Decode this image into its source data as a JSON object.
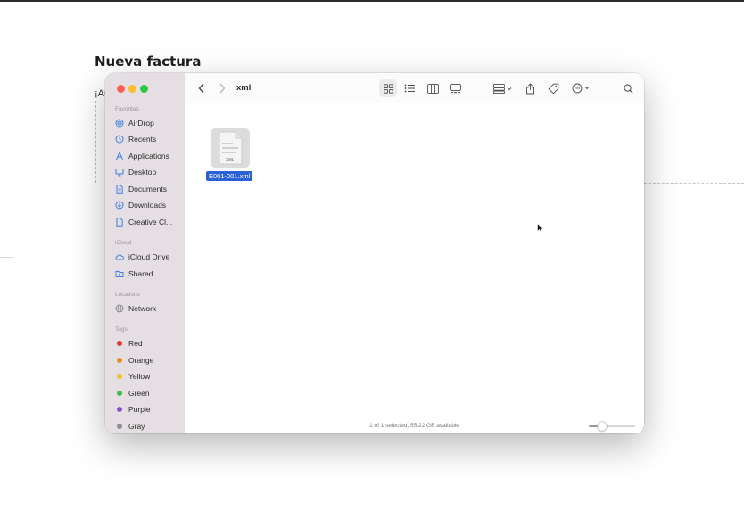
{
  "background": {
    "title": "Nueva factura",
    "partial_text": "¡Au"
  },
  "finder": {
    "toolbar": {
      "path_title": "xml",
      "back_icon": "chevron-left-icon",
      "forward_icon": "chevron-right-icon",
      "views": [
        "icon-view-icon",
        "list-view-icon",
        "column-view-icon",
        "gallery-view-icon"
      ],
      "selected_view": "icon-view-icon"
    },
    "sidebar": {
      "favorites_header": "Favorites",
      "favorites": [
        {
          "label": "AirDrop",
          "icon": "airdrop-icon"
        },
        {
          "label": "Recents",
          "icon": "clock-icon"
        },
        {
          "label": "Applications",
          "icon": "applications-icon"
        },
        {
          "label": "Desktop",
          "icon": "desktop-icon"
        },
        {
          "label": "Documents",
          "icon": "document-icon"
        },
        {
          "label": "Downloads",
          "icon": "download-icon"
        },
        {
          "label": "Creative Cl...",
          "icon": "file-icon"
        }
      ],
      "icloud_header": "iCloud",
      "icloud": [
        {
          "label": "iCloud Drive",
          "icon": "cloud-icon"
        },
        {
          "label": "Shared",
          "icon": "shared-folder-icon"
        }
      ],
      "locations_header": "Locations",
      "locations": [
        {
          "label": "Network",
          "icon": "globe-icon"
        }
      ],
      "tags_header": "Tags",
      "tags": [
        {
          "label": "Red",
          "color": "#e0382e"
        },
        {
          "label": "Orange",
          "color": "#f08a1c"
        },
        {
          "label": "Yellow",
          "color": "#f2c21b"
        },
        {
          "label": "Green",
          "color": "#3fbf4a"
        },
        {
          "label": "Purple",
          "color": "#8a4fd1"
        },
        {
          "label": "Gray",
          "color": "#8e8e93"
        }
      ]
    },
    "content": {
      "file_name": "E001-001.xml",
      "file_icon_text": "XML",
      "status": "1 of 1 selected, 55.22 GB available"
    }
  }
}
